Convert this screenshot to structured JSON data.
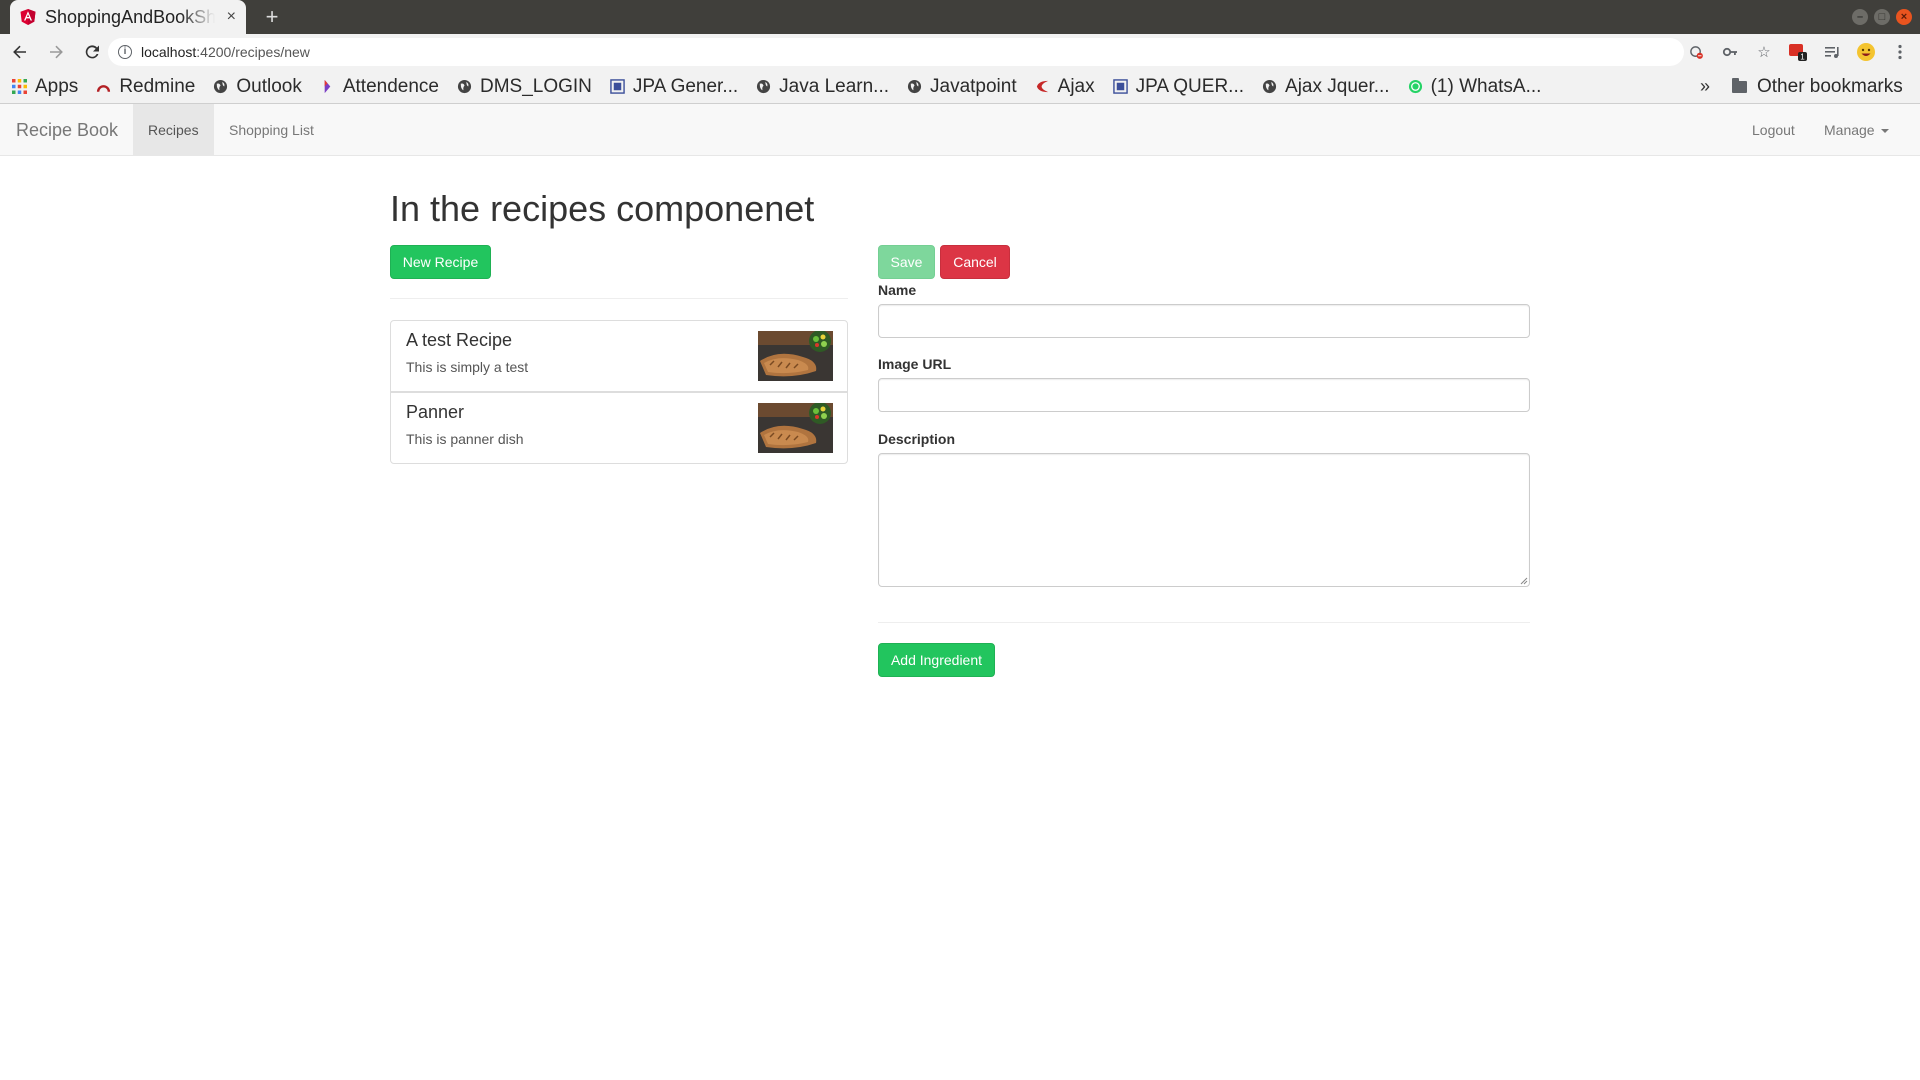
{
  "browser": {
    "tab_title": "ShoppingAndBookShop",
    "tab_close": "×",
    "new_tab": "+",
    "url_host": "localhost",
    "url_rest": ":4200/recipes/new",
    "icons": [
      "back-arrow-icon",
      "forward-arrow-icon",
      "reload-icon",
      "info-icon",
      "blocked-content-icon",
      "key-icon",
      "star-icon",
      "extension-icon",
      "media-icon",
      "emoji-avatar-icon",
      "kebab-menu-icon"
    ],
    "extension_badge": "1"
  },
  "bookmarks": {
    "items": [
      {
        "label": "Apps",
        "icon": "apps-grid-icon"
      },
      {
        "label": "Redmine",
        "icon": "redmine-icon"
      },
      {
        "label": "Outlook",
        "icon": "globe-icon"
      },
      {
        "label": "Attendence",
        "icon": "attendence-icon"
      },
      {
        "label": "DMS_LOGIN",
        "icon": "globe-icon"
      },
      {
        "label": "JPA Gener...",
        "icon": "doc-icon"
      },
      {
        "label": "Java Learn...",
        "icon": "globe-icon"
      },
      {
        "label": "Javatpoint",
        "icon": "globe-icon"
      },
      {
        "label": "Ajax",
        "icon": "ajax-icon"
      },
      {
        "label": "JPA QUER...",
        "icon": "doc-icon"
      },
      {
        "label": "Ajax Jquer...",
        "icon": "globe-icon"
      },
      {
        "label": "(1) WhatsA...",
        "icon": "whatsapp-icon"
      }
    ],
    "more": "»",
    "other": "Other bookmarks"
  },
  "navbar": {
    "brand": "Recipe Book",
    "recipes": "Recipes",
    "shopping_list": "Shopping List",
    "logout": "Logout",
    "manage": "Manage"
  },
  "page": {
    "heading": "In the recipes componenet",
    "new_recipe_button": "New Recipe"
  },
  "recipes": [
    {
      "name": "A test Recipe",
      "description": "This is simply a test"
    },
    {
      "name": "Panner",
      "description": "This is panner dish"
    }
  ],
  "form": {
    "save": "Save",
    "cancel": "Cancel",
    "name_label": "Name",
    "image_url_label": "Image URL",
    "description_label": "Description",
    "name_value": "",
    "image_url_value": "",
    "description_value": "",
    "add_ingredient": "Add Ingredient"
  },
  "colors": {
    "success": "#22c55e",
    "success_disabled": "#7ed79c",
    "danger": "#dc3545",
    "navbar_bg": "#f8f8f8"
  }
}
